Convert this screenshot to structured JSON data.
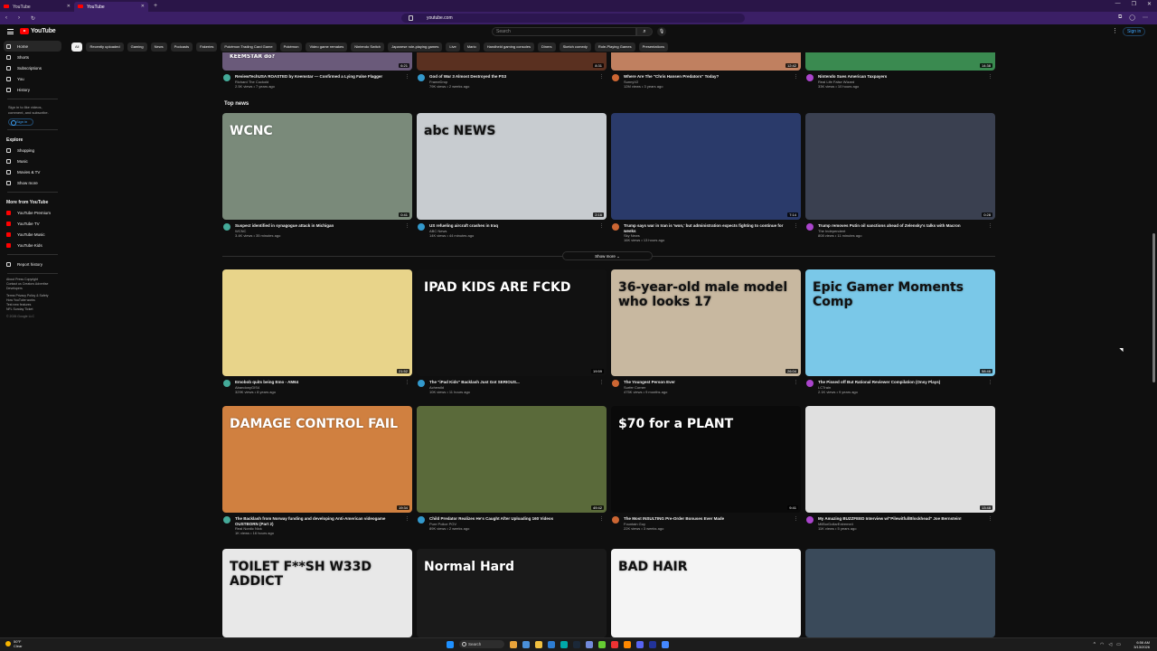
{
  "browser": {
    "tabs": [
      {
        "label": "YouTube",
        "active": false
      },
      {
        "label": "YouTube",
        "active": true
      }
    ],
    "url": "youtube.com"
  },
  "header": {
    "logo": "YouTube",
    "search_placeholder": "Search",
    "sign_in": "Sign in"
  },
  "chips": [
    "All",
    "Recently uploaded",
    "Gaming",
    "News",
    "Podcasts",
    "Fakeries",
    "Pokémon Trading Card Game",
    "Pokémon",
    "Video game remakes",
    "Nintendo Switch",
    "Japanese role-playing games",
    "Live",
    "Mario",
    "Handheld gaming consoles",
    "Diners",
    "Sketch comedy",
    "Role-Playing Games",
    "Presentations"
  ],
  "sidebar": {
    "items": [
      {
        "label": "Home",
        "icon": "home-icon"
      },
      {
        "label": "Shorts",
        "icon": "shorts-icon"
      },
      {
        "label": "Subscriptions",
        "icon": "subscriptions-icon"
      },
      {
        "label": "You",
        "icon": "you-icon"
      },
      {
        "label": "History",
        "icon": "history-icon"
      }
    ],
    "signin_text": "Sign in to like videos, comment, and subscribe.",
    "signin_button": "Sign in",
    "explore_heading": "Explore",
    "explore": [
      {
        "label": "Shopping"
      },
      {
        "label": "Music"
      },
      {
        "label": "Movies & TV"
      },
      {
        "label": "Show more"
      }
    ],
    "more_heading": "More from YouTube",
    "more": [
      {
        "label": "YouTube Premium"
      },
      {
        "label": "YouTube TV"
      },
      {
        "label": "YouTube Music"
      },
      {
        "label": "YouTube Kids"
      }
    ],
    "report": "Report history",
    "footer1": "About  Press  Copyright",
    "footer2": "Contact us  Creators  Advertise",
    "footer3": "Developers",
    "footer4": "Terms  Privacy  Policy & Safety",
    "footer5": "How YouTube works",
    "footer6": "Test new features",
    "footer7": "NFL Sunday Ticket",
    "footer8": "© 2026 Google LLC"
  },
  "row0": [
    {
      "title": "ReviewTechUSA ROASTED by Keemstar — Confirmed a Lying False Flagger",
      "channel": "Richard The Cuckold",
      "stats": "2.5K views • 7 years ago",
      "thumb_text": "KEEMSTAR do?",
      "dur": "6:21",
      "c": "#6a5a7a"
    },
    {
      "title": "God of War 3 Almost Destroyed the PS3",
      "channel": "FrameDrop",
      "stats": "79K views • 2 weeks ago",
      "thumb_text": "",
      "dur": "8:31",
      "c": "#5a3020"
    },
    {
      "title": "Where Are The \"Chris Hansen Predators\" Today?",
      "channel": "SunnyV2",
      "stats": "12M views • 3 years ago",
      "thumb_text": "",
      "dur": "12:42",
      "c": "#c08060"
    },
    {
      "title": "Nintendo Sues American Taxpayers",
      "channel": "Real Life False Wizard",
      "stats": "33K views • 10 hours ago",
      "thumb_text": "",
      "dur": "14:38",
      "c": "#3a8a50"
    }
  ],
  "top_news_label": "Top news",
  "news": [
    {
      "title": "Suspect identified in synagogue attack in Michigan",
      "channel": "WCNC",
      "stats": "3.4K views • 35 minutes ago",
      "thumb_text": "WCNC",
      "dur": "0:41",
      "c": "#7a8a7a"
    },
    {
      "title": "US refueling aircraft crashes in Iraq",
      "channel": "ABC News",
      "stats": "14K views • 44 minutes ago",
      "thumb_text": "abc NEWS",
      "dur": "2:16",
      "c": "#c8ccd0"
    },
    {
      "title": "Trump says war in Iran is 'won,' but administration expects fighting to continue for weeks",
      "channel": "Sky News",
      "stats": "16K views • 13 hours ago",
      "thumb_text": "",
      "dur": "7:14",
      "c": "#2a3a6a"
    },
    {
      "title": "Trump removes Putin oil sanctions ahead of Zelensky's talks with Macron",
      "channel": "The Independent",
      "stats": "808 views • 11 minutes ago",
      "thumb_text": "",
      "dur": "0:28",
      "c": "#3a4050"
    }
  ],
  "show_more": "Show more",
  "row2": [
    {
      "title": "Emobob quits being Emo - AM64",
      "channel": "AbandonyGIS4",
      "stats": "329K views • 8 years ago",
      "thumb_text": "",
      "dur": "21:52",
      "c": "#e8d48a"
    },
    {
      "title": "The \"iPad Kids\" Backlash Just Got SERIOUS...",
      "channel": "Achewild",
      "stats": "10K views • 11 hours ago",
      "thumb_text": "IPAD KIDS ARE FCKD",
      "dur": "19:59",
      "c": "#111111"
    },
    {
      "title": "The Youngest Person Ever",
      "channel": "Surfer Corner",
      "stats": "475K views • 9 months ago",
      "thumb_text": "36-year-old male model who looks 17",
      "dur": "26:04",
      "c": "#c8b8a0"
    },
    {
      "title": "The Pissed off But Rational Reviewer Compilation (Onsy Plays)",
      "channel": "LCTrain",
      "stats": "2.1K views • 9 years ago",
      "thumb_text": "Epic Gamer Moments Comp",
      "dur": "58:46",
      "c": "#7ac8e8"
    }
  ],
  "row3": [
    {
      "title": "The Backlash from Norway funding and developing Anti-American videogame OUSTBORN (Part 2)",
      "channel": "Real Nordic Nick",
      "stats": "1K views • 16 hours ago",
      "thumb_text": "DAMAGE CONTROL FAIL",
      "dur": "19:34",
      "c": "#d08040"
    },
    {
      "title": "Child Predator Realizes He's Caught After Uploading 160 Videos",
      "channel": "Pure Police POV",
      "stats": "89K views • 2 weeks ago",
      "thumb_text": "",
      "dur": "49:42",
      "c": "#5a6a3a"
    },
    {
      "title": "The Most INSULTING Pre-Order Bonuses Ever Made",
      "channel": "Fountain Guy",
      "stats": "22K views • 3 weeks ago",
      "thumb_text": "$70 for a PLANT",
      "dur": "9:41",
      "c": "#0a0a0a"
    },
    {
      "title": "My Amazing BUZZFEED Interview w/\"Pilewitful/Blockhead\" Joe Bernstein!",
      "channel": "MilBorDollarExtreme4",
      "stats": "11K views • 5 years ago",
      "thumb_text": "",
      "dur": "13:48",
      "c": "#e0e0e0"
    }
  ],
  "row4": [
    {
      "title": "",
      "channel": "",
      "stats": "",
      "thumb_text": "TOILET F**SH  W33D ADDICT",
      "dur": "",
      "c": "#e8e8e8"
    },
    {
      "title": "",
      "channel": "",
      "stats": "",
      "thumb_text": "Normal  Hard",
      "dur": "",
      "c": "#1a1a1a"
    },
    {
      "title": "",
      "channel": "",
      "stats": "",
      "thumb_text": "BAD HAIR",
      "dur": "",
      "c": "#f4f4f4"
    },
    {
      "title": "",
      "channel": "",
      "stats": "",
      "thumb_text": "",
      "dur": "",
      "c": "#3a4a5a"
    }
  ],
  "taskbar": {
    "weather_temp": "50°F",
    "weather_desc": "Clear",
    "search": "Search",
    "time": "6:56 AM",
    "date": "3/13/2026"
  }
}
